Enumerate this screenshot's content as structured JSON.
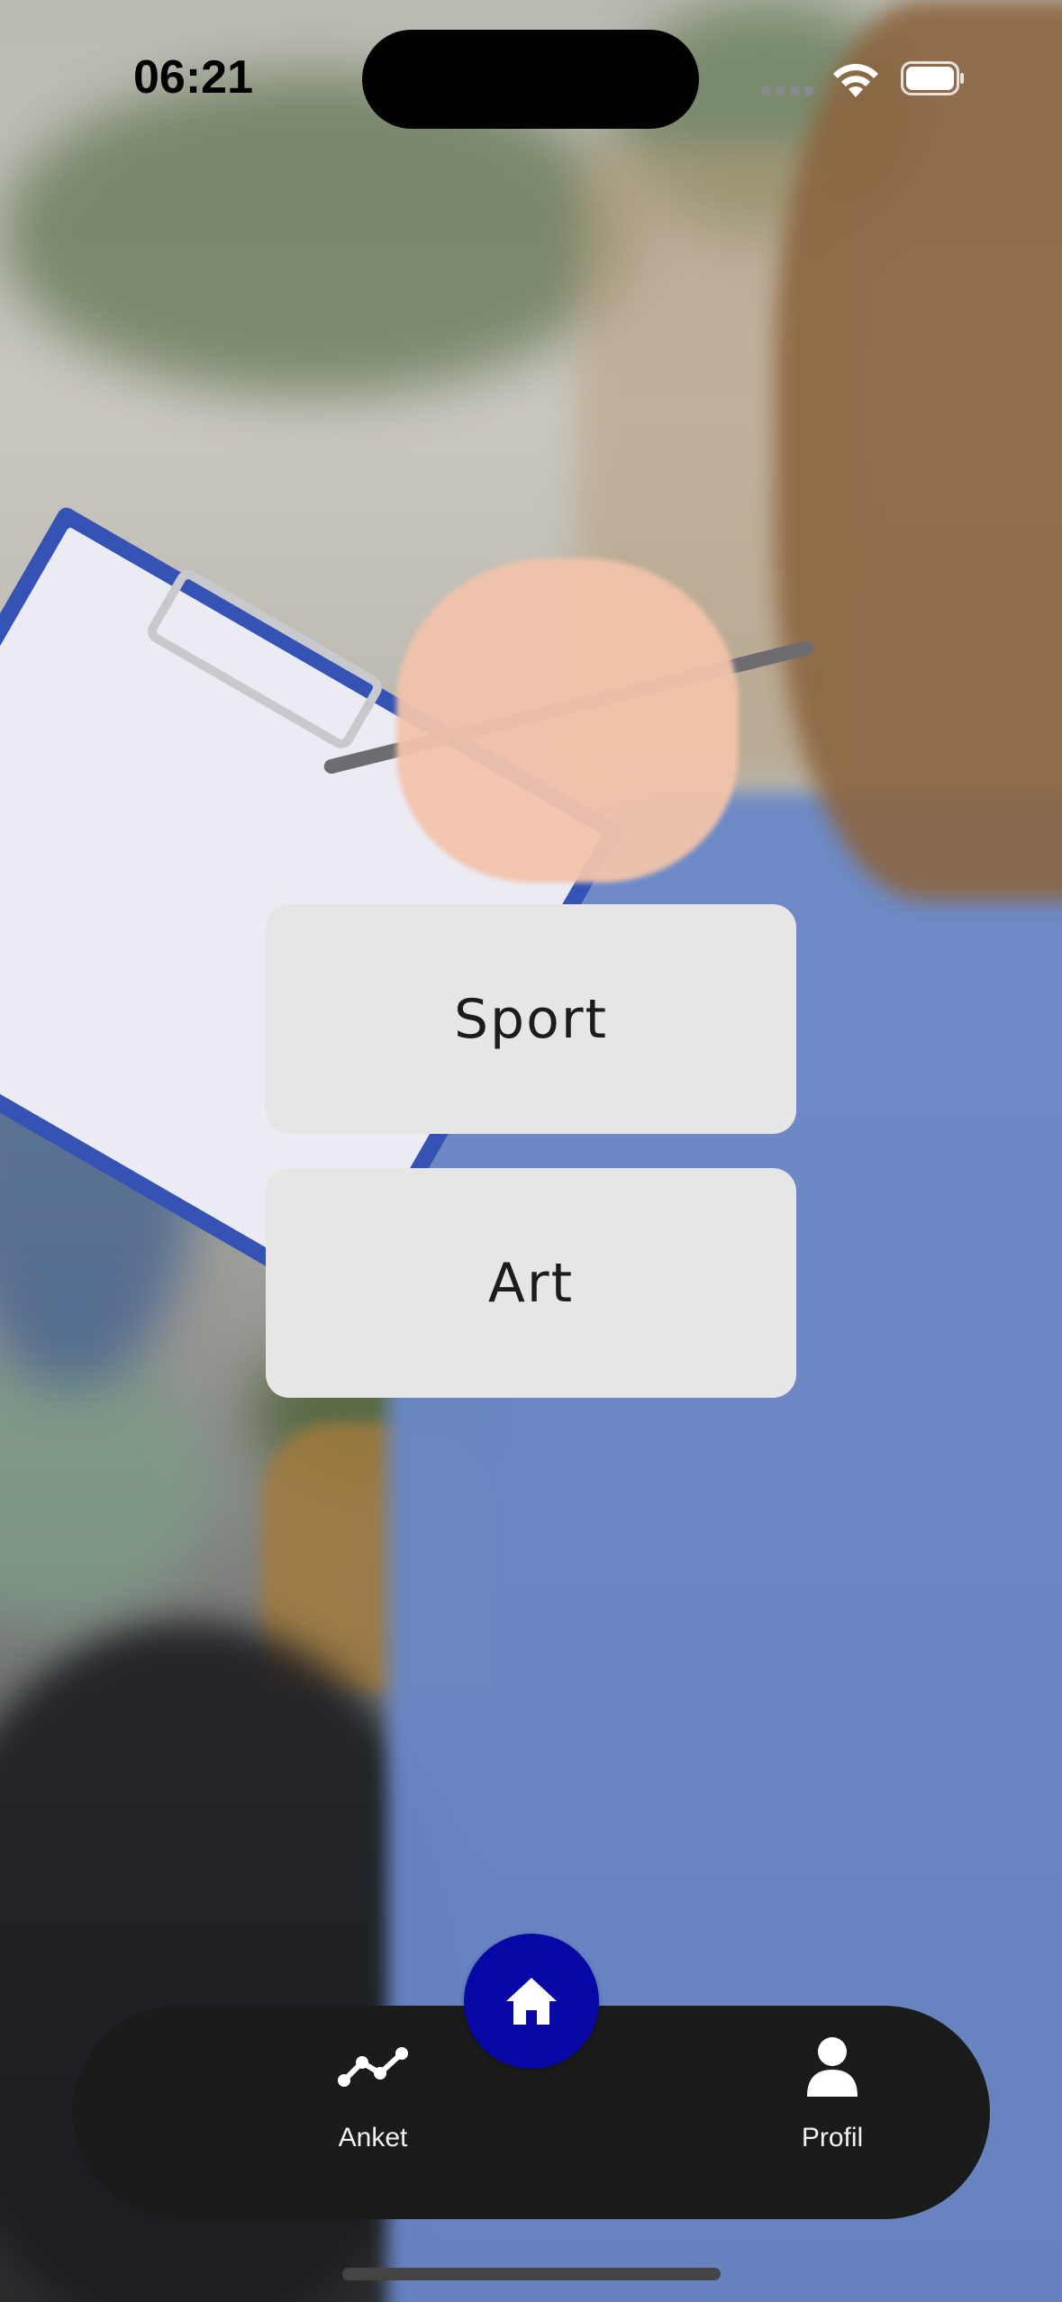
{
  "status_bar": {
    "time": "06:21",
    "icons": [
      "cellular-signal-icon",
      "wifi-icon",
      "battery-icon"
    ]
  },
  "categories": [
    {
      "label": "Sport"
    },
    {
      "label": "Art"
    }
  ],
  "bottom_nav": {
    "items": [
      {
        "label": "Anket",
        "icon": "chart-line-icon"
      },
      {
        "label": "Profil",
        "icon": "person-icon"
      }
    ],
    "center_button": {
      "icon": "home-icon"
    }
  },
  "colors": {
    "accent": "#0808a6",
    "nav_background": "#1b1b1b",
    "button_background": "#e7e6e4",
    "button_text": "#1c1c1c"
  }
}
